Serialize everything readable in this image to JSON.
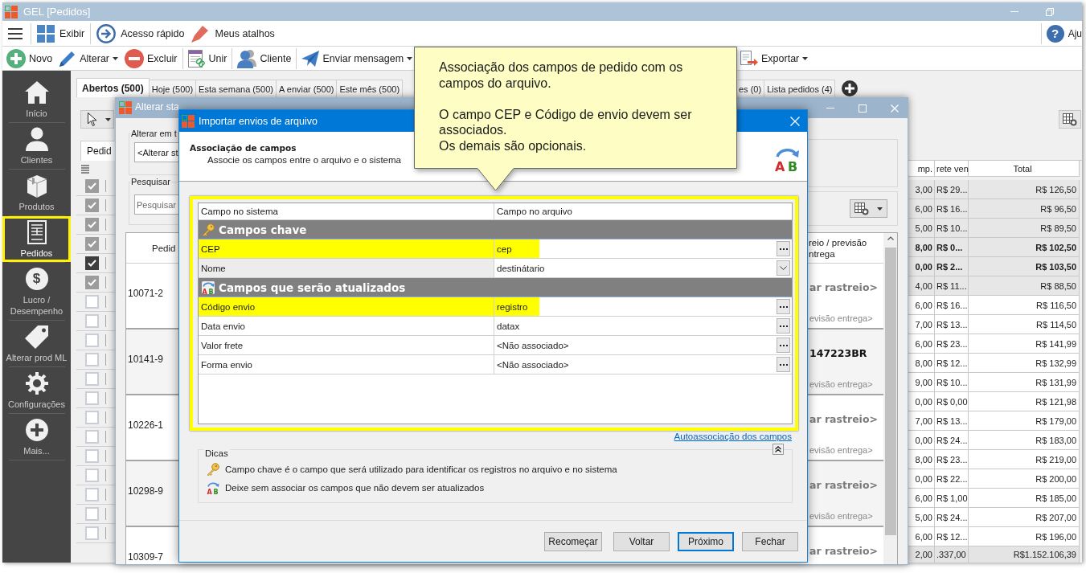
{
  "window": {
    "title": "GEL [Pedidos]"
  },
  "menu_bar": {
    "items": [
      {
        "label": "Exibir"
      },
      {
        "label": "Acesso rápido"
      },
      {
        "label": "Meus atalhos"
      }
    ],
    "help": {
      "symbol": "?",
      "label": "Aju"
    }
  },
  "toolbar": {
    "groups": [
      [
        {
          "label": "Novo",
          "dropdown": false
        },
        {
          "label": "Alterar",
          "dropdown": true
        },
        {
          "label": "Excluir",
          "dropdown": false
        }
      ],
      [
        {
          "label": "Unir",
          "dropdown": false
        }
      ],
      [
        {
          "label": "Cliente",
          "dropdown": false
        }
      ],
      [
        {
          "label": "Enviar mensagem",
          "dropdown": true
        }
      ]
    ],
    "export": {
      "label": "Exportar",
      "dropdown": true
    }
  },
  "sidebar": {
    "items": [
      {
        "label": "Início",
        "selected": false
      },
      {
        "label": "Clientes",
        "selected": false
      },
      {
        "label": "Produtos",
        "selected": false
      },
      {
        "label": "Pedidos",
        "selected": true
      },
      {
        "label": "Lucro / Desempenho",
        "selected": false,
        "symbol": "$"
      },
      {
        "label": "Alterar prod ML",
        "selected": false
      },
      {
        "label": "Configurações",
        "selected": false
      },
      {
        "label": "Mais...",
        "selected": false
      }
    ]
  },
  "tabs": [
    {
      "label": "Abertos (500)",
      "selected": true
    },
    {
      "label": "Hoje (500)",
      "selected": false
    },
    {
      "label": "Esta semana (500)",
      "selected": false
    },
    {
      "label": "A enviar (500)",
      "selected": false
    },
    {
      "label": "Este mês (500)",
      "selected": false
    }
  ],
  "more_tabs": [
    {
      "label": "es (0)",
      "selected": false
    },
    {
      "label": "Lista pedidos (4)",
      "selected": false
    }
  ],
  "orders": {
    "tab": "Pedid",
    "columns": [
      "mp.",
      "rete ven",
      "Total"
    ],
    "rows": [
      {
        "checked": true,
        "current": false,
        "bold": false,
        "cells": [
          "3,00",
          "R$ 29...",
          "R$ 126,50"
        ]
      },
      {
        "checked": true,
        "current": false,
        "bold": false,
        "cells": [
          "6,00",
          "R$ 16...",
          "R$ 96,50"
        ]
      },
      {
        "checked": true,
        "current": false,
        "bold": false,
        "cells": [
          "5,00",
          "R$ 10...",
          "R$ 89,50"
        ]
      },
      {
        "checked": true,
        "current": false,
        "bold": true,
        "cells": [
          "8,00",
          "R$ 0...",
          "R$ 102,50"
        ]
      },
      {
        "checked": true,
        "current": true,
        "bold": true,
        "cells": [
          "0,00",
          "R$ 2...",
          "R$ 103,50"
        ]
      },
      {
        "checked": true,
        "current": false,
        "bold": false,
        "cells": [
          "4,00",
          "R$ 11...",
          "R$ 88,50"
        ]
      },
      {
        "checked": false,
        "current": false,
        "bold": false,
        "cells": [
          "6,00",
          "R$ 16...",
          "R$ 116,50"
        ]
      },
      {
        "checked": false,
        "current": false,
        "bold": false,
        "cells": [
          "7,00",
          "R$ 13...",
          "R$ 114,50"
        ]
      },
      {
        "checked": false,
        "current": false,
        "bold": false,
        "cells": [
          "6,00",
          "R$ 23...",
          "R$ 141,99"
        ]
      },
      {
        "checked": false,
        "current": false,
        "bold": false,
        "cells": [
          "8,00",
          "R$ 12...",
          "R$ 132,99"
        ]
      },
      {
        "checked": false,
        "current": false,
        "bold": false,
        "cells": [
          "9,00",
          "R$ 10...",
          "R$ 131,99"
        ]
      },
      {
        "checked": false,
        "current": false,
        "bold": false,
        "cells": [
          "0,00",
          "R$ 0,00",
          "R$ 121,98"
        ]
      },
      {
        "checked": false,
        "current": false,
        "bold": false,
        "cells": [
          "7,00",
          "R$ 13...",
          "R$ 179,00"
        ]
      },
      {
        "checked": false,
        "current": false,
        "bold": false,
        "cells": [
          "0,00",
          "R$ 24...",
          "R$ 183,00"
        ]
      },
      {
        "checked": false,
        "current": false,
        "bold": false,
        "cells": [
          "8,00",
          "R$ 23...",
          "R$ 219,00"
        ]
      },
      {
        "checked": false,
        "current": false,
        "bold": false,
        "cells": [
          "0,00",
          "R$ 22...",
          "R$ 200,00"
        ]
      },
      {
        "checked": false,
        "current": false,
        "bold": false,
        "cells": [
          "6,00",
          "R$ 1,00",
          "R$ 185,00"
        ]
      },
      {
        "checked": false,
        "current": false,
        "bold": false,
        "cells": [
          "5,00",
          "R$ 24...",
          "R$ 207,00"
        ]
      },
      {
        "checked": false,
        "current": false,
        "bold": false,
        "cells": [
          "6,00",
          "R$ 12...",
          "R$ 196,00"
        ]
      }
    ],
    "totals": [
      "2,00",
      ".337,00",
      "R$1.152.106,39"
    ]
  },
  "status_window": {
    "title": "Alterar sta",
    "change": {
      "legend": "Alterar em t",
      "value": "<Alterar st"
    },
    "search": {
      "legend": "Pesquisar",
      "placeholder": "Pesquisar"
    },
    "list": {
      "columns": [
        "Pedid",
        "reio / previsão ntrega"
      ],
      "rows": [
        {
          "order": "10071-2",
          "tracking": {
            "kind": "link",
            "text": "ar rastreio>"
          },
          "forecast": "evisão entrega>"
        },
        {
          "order": "10141-9",
          "tracking": {
            "kind": "code",
            "text": "147223BR"
          },
          "forecast": "evisão entrega>"
        },
        {
          "order": "10226-1",
          "tracking": {
            "kind": "link",
            "text": "ar rastreio>"
          },
          "forecast": "evisão entrega>"
        },
        {
          "order": "10298-9",
          "tracking": {
            "kind": "link",
            "text": "ar rastreio>"
          },
          "forecast": "evisão entrega>"
        },
        {
          "order": "10309-7",
          "tracking": {
            "kind": "link",
            "text": "ar rastreio>"
          }
        }
      ]
    }
  },
  "dialog": {
    "title": "Importar envios de arquivo",
    "heading": "Associação de campos",
    "subheading": "Associe os campos entre o arquivo e o sistema",
    "header_icon": [
      "A",
      "B"
    ],
    "grid": {
      "highlighted": true,
      "columns": [
        "Campo no sistema",
        "Campo no arquivo"
      ],
      "groups": [
        {
          "label": "Campos chave",
          "kind": "key",
          "rows": [
            {
              "field": "CEP",
              "value": "cep",
              "kind": "browse",
              "highlighted": true,
              "selected": false
            },
            {
              "field": "Nome",
              "value": "destinátario",
              "kind": "dropdown",
              "highlighted": false,
              "selected": true
            }
          ]
        },
        {
          "label": "Campos que serão atualizados",
          "kind": "update",
          "icon_letters": [
            "A",
            "B"
          ],
          "rows": [
            {
              "field": "Código envio",
              "value": "registro",
              "kind": "browse",
              "highlighted": true,
              "selected": false
            },
            {
              "field": "Data envio",
              "value": "datax",
              "kind": "browse",
              "highlighted": false,
              "selected": false
            },
            {
              "field": "Valor frete",
              "value": "<Não associado>",
              "kind": "browse",
              "highlighted": false,
              "selected": false
            },
            {
              "field": "Forma envio",
              "value": "<Não associado>",
              "kind": "browse",
              "highlighted": false,
              "selected": false
            }
          ]
        }
      ]
    },
    "link": "Autoassociação dos campos",
    "tips": {
      "legend": "Dicas",
      "items": [
        {
          "kind": "key",
          "text": "Campo chave é o campo que será utilizado para identificar os registros no arquivo e no sistema"
        },
        {
          "kind": "update",
          "icon_letters": [
            "A",
            "B"
          ],
          "text": "Deixe sem associar os campos que não devem ser atualizados"
        }
      ]
    },
    "buttons": [
      {
        "label": "Recomeçar",
        "default": false
      },
      {
        "label": "Voltar",
        "default": false
      },
      {
        "label": "Próximo",
        "default": true
      },
      {
        "label": "Fechar",
        "default": false
      }
    ]
  },
  "callout": {
    "paragraphs": [
      [
        "Associação dos campos de pedido com os campos do arquivo."
      ],
      [
        "O campo CEP e Código de envio devem ser associados.",
        "Os demais são opcionais."
      ]
    ]
  }
}
